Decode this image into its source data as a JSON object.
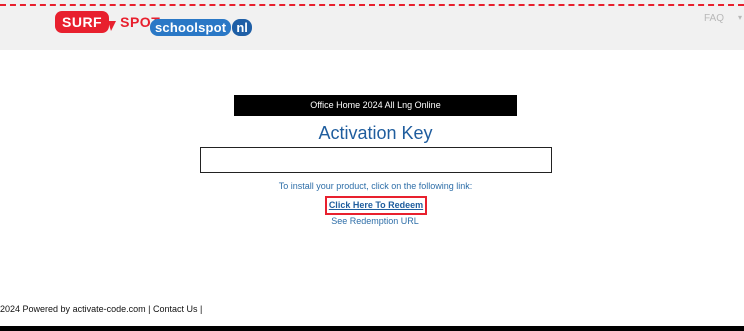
{
  "header": {
    "surf_logo_text": "SURF",
    "spot_logo_text": "SPOT",
    "school_logo_text": "schoolspot",
    "school_logo_suffix": "nl",
    "faq_label": "FAQ",
    "faq_caret_icon": "chevron-down-icon"
  },
  "main": {
    "product_name": "Office Home 2024 All Lng Online",
    "activation_title": "Activation Key",
    "key_value": "",
    "instruction": "To install your product, click on the following link:",
    "redeem_link": "Click Here To Redeem",
    "redemption_url_link": "See Redemption URL"
  },
  "footer": {
    "prefix": "2024 Powered by ",
    "site_link": "activate-code.com",
    "separator": " | ",
    "contact_link": "Contact Us",
    "suffix": " |"
  },
  "colors": {
    "brand_red": "#e8202e",
    "link_blue": "#1f5d9e",
    "school_blue": "#2a78c6",
    "header_bg": "#f1f1f1"
  }
}
